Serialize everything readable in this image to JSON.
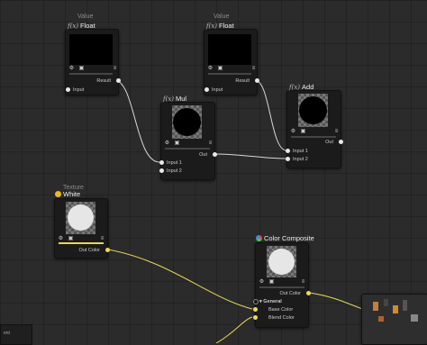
{
  "nodes": {
    "value1": {
      "category": "Value",
      "title": "Float",
      "fx": "f(x)",
      "input": "Input",
      "output": "Result"
    },
    "value2": {
      "category": "Value",
      "title": "Float",
      "fx": "f(x)",
      "input": "Input",
      "output": "Result"
    },
    "mul": {
      "title": "Mul",
      "fx": "f(x)",
      "input1": "Input 1",
      "input2": "Input 2",
      "output": "Out"
    },
    "add": {
      "title": "Add",
      "fx": "f(x)",
      "input1": "Input 1",
      "input2": "Input 2",
      "output": "Out"
    },
    "texture": {
      "category": "Texture",
      "title": "White",
      "output": "Out Color"
    },
    "composite": {
      "title": "Color Composite",
      "output": "Out Color",
      "group": "General",
      "input1": "Base Color",
      "input2": "Blend Color"
    }
  },
  "colors": {
    "wire_white": "#d8d8d8",
    "wire_yellow": "#e8d65a",
    "node_bg": "#1b1b1b",
    "canvas": "#2b2b2b"
  },
  "icons": [
    "settings-icon",
    "image-icon",
    "menu-icon",
    "texture-icon",
    "palette-icon"
  ],
  "corner_label": "ent"
}
